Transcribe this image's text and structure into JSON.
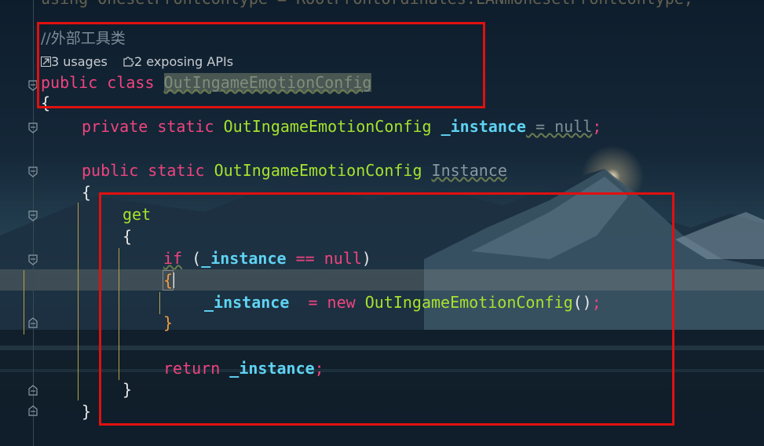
{
  "editor": {
    "top_partial": "using OnesetFrontContype = RootFrontOrdinates.LANmOnesetFrontContype;",
    "comment": "//外部工具类",
    "codelens": {
      "usages": "3 usages",
      "apis": "2 exposing APIs"
    },
    "lines": {
      "l1_kw": "public class ",
      "l1_name": "OutIngameEmotionConfig",
      "l2": "{",
      "l3_kw": "private static ",
      "l3_type": "OutIngameEmotionConfig ",
      "l3_field": "_instance",
      "l3_rest": " = null",
      "l3_semi": ";",
      "l4_kw": "public static ",
      "l4_type": "OutIngameEmotionConfig ",
      "l4_prop": "Instance",
      "l5": "{",
      "l6": "get",
      "l7": "{",
      "l8_kw": "if",
      "l8_open": " (",
      "l8_field": "_instance",
      "l8_op": " == ",
      "l8_null": "null",
      "l8_close": ")",
      "l9": "{",
      "l10_field": "_instance",
      "l10_eq": "  = ",
      "l10_new": "new ",
      "l10_type": "OutIngameEmotionConfig",
      "l10_paren": "()",
      "l10_semi": ";",
      "l11": "}",
      "l12_kw": "return ",
      "l12_field": "_instance",
      "l12_semi": ";",
      "l13": "}",
      "l14": "}"
    }
  },
  "colors": {
    "keyword": "#f0447f",
    "type": "#a6e22e",
    "field": "#5fd3f3",
    "annotation_box": "#e01010"
  }
}
